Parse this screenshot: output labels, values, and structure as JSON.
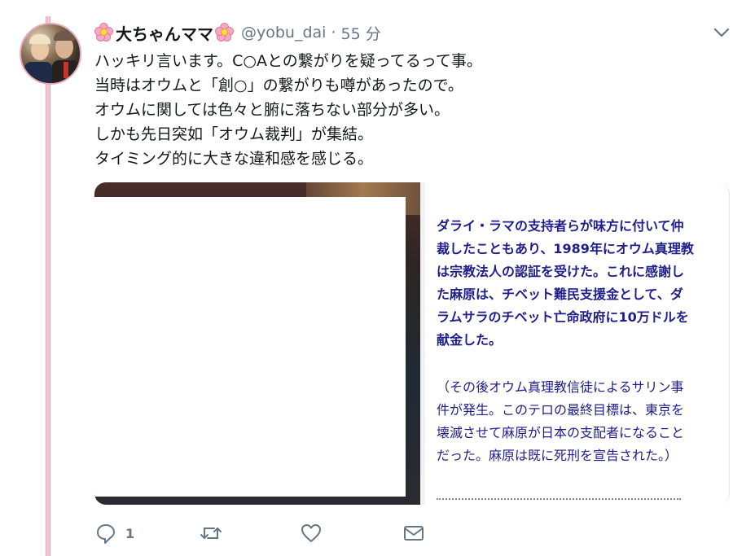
{
  "tweet": {
    "display_name": "大ちゃんママ",
    "handle": "@yobu_dai",
    "separator": "·",
    "time": "55 分",
    "lines": [
      "ハッキリ言います。C○Aとの繋がりを疑ってるって事。",
      "当時はオウムと「創○」の繋がりも噂があったので。",
      "オウムに関しては色々と腑に落ちない部分が多い。",
      "しかも先日突如「オウム裁判」が集結。",
      "タイミング的に大きな違和感を感じる。"
    ]
  },
  "media": {
    "main_lines": [
      "ダライ・ラマの支持者らが味方に付いて仲",
      "裁したこともあり、1989年にオウム真理教",
      "は宗教法人の認証を受けた。これに感謝し",
      "た麻原は、チベット難民支援金として、ダ",
      "ラムサラのチベット亡命政府に10万ドルを",
      "献金した。"
    ],
    "sub_lines": [
      "（その後オウム真理教信徒によるサリン事",
      "件が発生。このテロの最終目標は、東京を",
      "壊滅させて麻原が日本の支配者になること",
      "だった。麻原は既に死刑を宣告された。）"
    ]
  },
  "actions": {
    "reply_count": "1",
    "retweet_count": "",
    "like_count": ""
  },
  "icons": {
    "avatar": "avatar-photo",
    "name_decoration": "cherry-blossom-icon",
    "menu": "chevron-down-icon",
    "reply": "reply-icon",
    "retweet": "retweet-icon",
    "like": "heart-icon",
    "dm": "envelope-icon"
  },
  "colors": {
    "thread_line": "#f3c7d2",
    "secondary_text": "#657786",
    "media_text": "#1f1f8c"
  }
}
